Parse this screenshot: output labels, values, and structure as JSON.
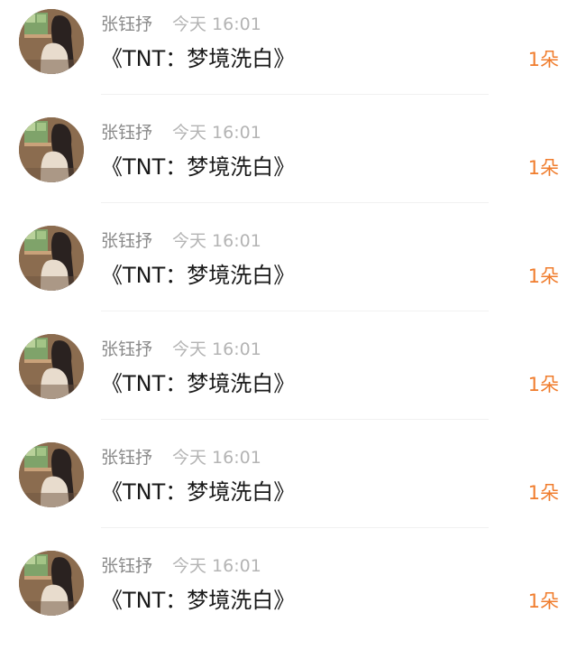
{
  "items": [
    {
      "user": "张钰抒",
      "time": "今天 16:01",
      "message": "《TNT：梦境洗白》",
      "count": "1朵"
    },
    {
      "user": "张钰抒",
      "time": "今天 16:01",
      "message": "《TNT：梦境洗白》",
      "count": "1朵"
    },
    {
      "user": "张钰抒",
      "time": "今天 16:01",
      "message": "《TNT：梦境洗白》",
      "count": "1朵"
    },
    {
      "user": "张钰抒",
      "time": "今天 16:01",
      "message": "《TNT：梦境洗白》",
      "count": "1朵"
    },
    {
      "user": "张钰抒",
      "time": "今天 16:01",
      "message": "《TNT：梦境洗白》",
      "count": "1朵"
    },
    {
      "user": "张钰抒",
      "time": "今天 16:01",
      "message": "《TNT：梦境洗白》",
      "count": "1朵"
    }
  ],
  "colors": {
    "username": "#8a8a8a",
    "time": "#b4b4b4",
    "message": "#1a1a1a",
    "count": "#f07c2c"
  }
}
